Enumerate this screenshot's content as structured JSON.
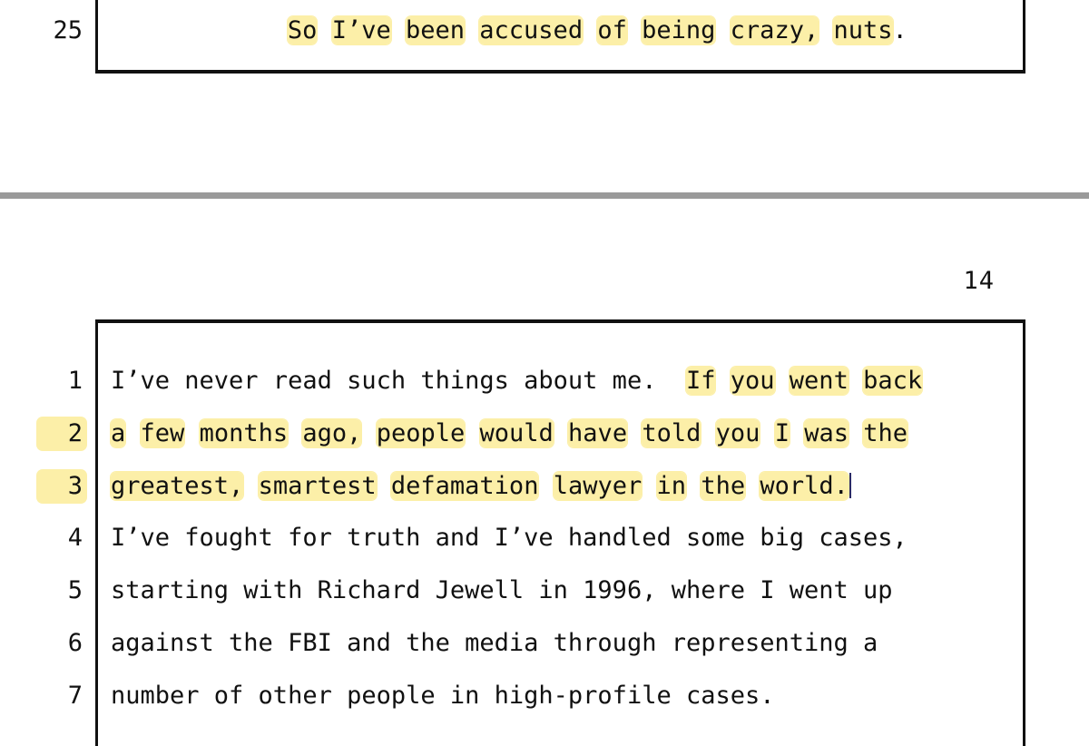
{
  "document": {
    "type": "deposition-transcript",
    "separator_color": "#9a9a9a",
    "highlight_color": "#fcefa8",
    "text_color": "#111111",
    "border_color": "#111111"
  },
  "page_top": {
    "lines": [
      {
        "number": "25",
        "number_highlighted": false,
        "indent_chars": 11,
        "tokens": [
          {
            "text": "So",
            "highlight": true
          },
          {
            "text": " ",
            "highlight": false
          },
          {
            "text": "I’ve",
            "highlight": true
          },
          {
            "text": " ",
            "highlight": false
          },
          {
            "text": "been",
            "highlight": true
          },
          {
            "text": " ",
            "highlight": false
          },
          {
            "text": "accused",
            "highlight": true
          },
          {
            "text": " ",
            "highlight": false
          },
          {
            "text": "of",
            "highlight": true
          },
          {
            "text": " ",
            "highlight": false
          },
          {
            "text": "being",
            "highlight": true
          },
          {
            "text": " ",
            "highlight": false
          },
          {
            "text": "crazy,",
            "highlight": true
          },
          {
            "text": " ",
            "highlight": false
          },
          {
            "text": "nuts",
            "highlight": true
          },
          {
            "text": ".",
            "highlight": false
          }
        ],
        "plain": "So I’ve been accused of being crazy, nuts."
      }
    ]
  },
  "page_bottom": {
    "page_number": "14",
    "lines": [
      {
        "number": "1",
        "number_highlighted": false,
        "indent_chars": 0,
        "tokens": [
          {
            "text": "I’ve never read such things about me.  ",
            "highlight": false
          },
          {
            "text": "If",
            "highlight": true
          },
          {
            "text": " ",
            "highlight": false
          },
          {
            "text": "you",
            "highlight": true
          },
          {
            "text": " ",
            "highlight": false
          },
          {
            "text": "went",
            "highlight": true
          },
          {
            "text": " ",
            "highlight": false
          },
          {
            "text": "back",
            "highlight": true
          }
        ],
        "plain": "I’ve never read such things about me.  If you went back"
      },
      {
        "number": "2",
        "number_highlighted": true,
        "indent_chars": 0,
        "tokens": [
          {
            "text": "a",
            "highlight": true
          },
          {
            "text": " ",
            "highlight": false
          },
          {
            "text": "few",
            "highlight": true
          },
          {
            "text": " ",
            "highlight": false
          },
          {
            "text": "months",
            "highlight": true
          },
          {
            "text": " ",
            "highlight": false
          },
          {
            "text": "ago,",
            "highlight": true
          },
          {
            "text": " ",
            "highlight": false
          },
          {
            "text": "people",
            "highlight": true
          },
          {
            "text": " ",
            "highlight": false
          },
          {
            "text": "would",
            "highlight": true
          },
          {
            "text": " ",
            "highlight": false
          },
          {
            "text": "have",
            "highlight": true
          },
          {
            "text": " ",
            "highlight": false
          },
          {
            "text": "told",
            "highlight": true
          },
          {
            "text": " ",
            "highlight": false
          },
          {
            "text": "you",
            "highlight": true
          },
          {
            "text": " ",
            "highlight": false
          },
          {
            "text": "I",
            "highlight": true
          },
          {
            "text": " ",
            "highlight": false
          },
          {
            "text": "was",
            "highlight": true
          },
          {
            "text": " ",
            "highlight": false
          },
          {
            "text": "the",
            "highlight": true
          }
        ],
        "plain": "a few months ago, people would have told you I was the"
      },
      {
        "number": "3",
        "number_highlighted": true,
        "indent_chars": 0,
        "caret": true,
        "tokens": [
          {
            "text": "greatest,",
            "highlight": true
          },
          {
            "text": " ",
            "highlight": false
          },
          {
            "text": "smartest",
            "highlight": true
          },
          {
            "text": " ",
            "highlight": false
          },
          {
            "text": "defamation",
            "highlight": true
          },
          {
            "text": " ",
            "highlight": false
          },
          {
            "text": "lawyer",
            "highlight": true
          },
          {
            "text": " ",
            "highlight": false
          },
          {
            "text": "in",
            "highlight": true
          },
          {
            "text": " ",
            "highlight": false
          },
          {
            "text": "the",
            "highlight": true
          },
          {
            "text": " ",
            "highlight": false
          },
          {
            "text": "world.",
            "highlight": true
          }
        ],
        "plain": "greatest, smartest defamation lawyer in the world."
      },
      {
        "number": "4",
        "number_highlighted": false,
        "indent_chars": 0,
        "tokens": [
          {
            "text": "I’ve fought for truth and I’ve handled some big cases,",
            "highlight": false
          }
        ],
        "plain": "I’ve fought for truth and I’ve handled some big cases,"
      },
      {
        "number": "5",
        "number_highlighted": false,
        "indent_chars": 0,
        "tokens": [
          {
            "text": "starting with Richard Jewell in 1996, where I went up",
            "highlight": false
          }
        ],
        "plain": "starting with Richard Jewell in 1996, where I went up"
      },
      {
        "number": "6",
        "number_highlighted": false,
        "indent_chars": 0,
        "tokens": [
          {
            "text": "against the FBI and the media through representing a",
            "highlight": false
          }
        ],
        "plain": "against the FBI and the media through representing a"
      },
      {
        "number": "7",
        "number_highlighted": false,
        "indent_chars": 0,
        "tokens": [
          {
            "text": "number of other people in high-profile cases.",
            "highlight": false
          }
        ],
        "plain": "number of other people in high-profile cases."
      }
    ]
  }
}
